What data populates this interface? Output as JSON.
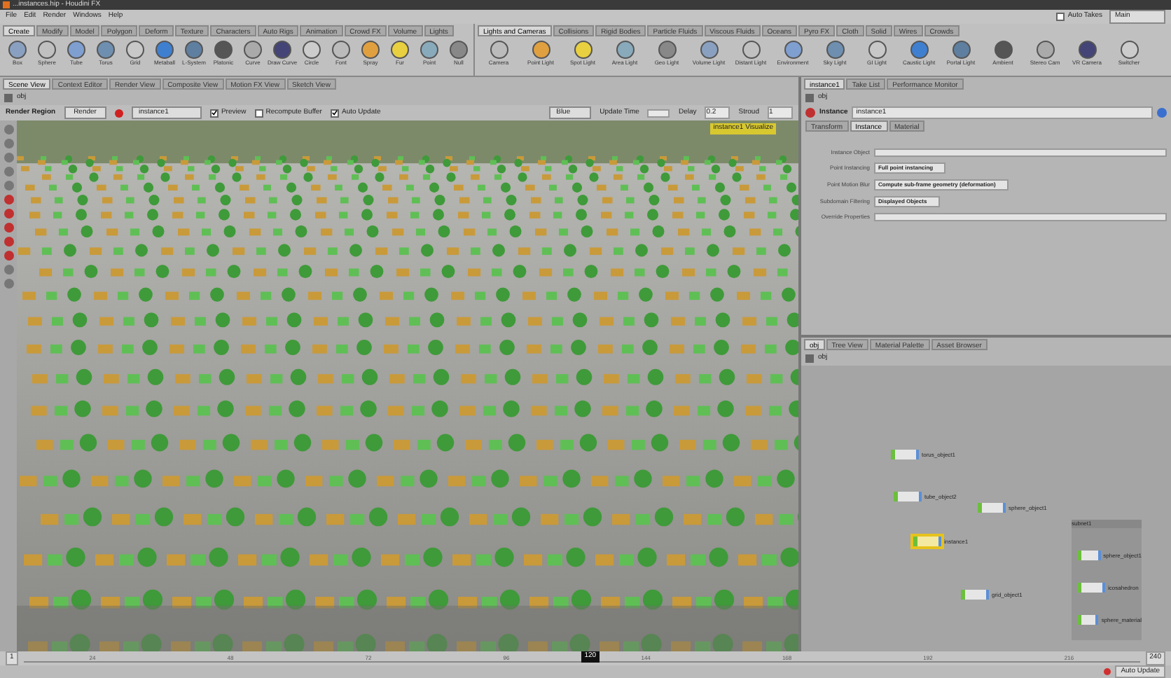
{
  "window": {
    "title": "...instances.hip - Houdini FX"
  },
  "menu": [
    "File",
    "Edit",
    "Render",
    "Windows",
    "Help"
  ],
  "desk": {
    "auto_takes": {
      "label": "Auto Takes",
      "checked": false
    },
    "take": "Main"
  },
  "shelf_tabs": [
    {
      "label": "Create",
      "selected": true
    },
    {
      "label": "Modify",
      "selected": false
    },
    {
      "label": "Model",
      "selected": false
    },
    {
      "label": "Polygon",
      "selected": false
    },
    {
      "label": "Deform",
      "selected": false
    },
    {
      "label": "Texture",
      "selected": false
    },
    {
      "label": "Characters",
      "selected": false
    },
    {
      "label": "Auto Rigs",
      "selected": false
    },
    {
      "label": "Animation",
      "selected": false
    },
    {
      "label": "Crowd FX",
      "selected": false
    },
    {
      "label": "Volume",
      "selected": false
    },
    {
      "label": "Lights",
      "selected": false
    }
  ],
  "shelf_tools": [
    "Box",
    "Sphere",
    "Tube",
    "Torus",
    "Grid",
    "Metaball",
    "L-System",
    "Platonic",
    "Curve",
    "Draw Curve",
    "Circle",
    "Font",
    "Spray",
    "Fur",
    "Point",
    "Null"
  ],
  "light_tabs": [
    {
      "label": "Lights and Cameras",
      "selected": true
    },
    {
      "label": "Collisions",
      "selected": false
    },
    {
      "label": "Rigid Bodies",
      "selected": false
    },
    {
      "label": "Particle Fluids",
      "selected": false
    },
    {
      "label": "Viscous Fluids",
      "selected": false
    },
    {
      "label": "Oceans",
      "selected": false
    },
    {
      "label": "Pyro FX",
      "selected": false
    },
    {
      "label": "Cloth",
      "selected": false
    },
    {
      "label": "Solid",
      "selected": false
    },
    {
      "label": "Wires",
      "selected": false
    },
    {
      "label": "Crowds",
      "selected": false
    }
  ],
  "light_tools": [
    "Camera",
    "Point Light",
    "Spot Light",
    "Area Light",
    "Geo Light",
    "Volume Light",
    "Distant Light",
    "Environment",
    "Sky Light",
    "GI Light",
    "Caustic Light",
    "Portal Light",
    "Ambient",
    "Stereo Cam",
    "VR Camera",
    "Switcher"
  ],
  "view_tabs": [
    {
      "label": "Scene View",
      "selected": true
    },
    {
      "label": "Context Editor",
      "selected": false
    },
    {
      "label": "Render View",
      "selected": false
    },
    {
      "label": "Composite View",
      "selected": false
    },
    {
      "label": "Motion FX View",
      "selected": false
    },
    {
      "label": "Sketch View",
      "selected": false
    }
  ],
  "view_path": "obj",
  "render_bar": {
    "title": "Render Region",
    "render": "Render",
    "camera": "instance1",
    "preview": {
      "label": "Preview",
      "checked": true
    },
    "buffer": {
      "label": "Recompute Buffer",
      "checked": false
    },
    "auto": {
      "label": "Auto Update",
      "checked": true
    },
    "channel": "Blue",
    "update_time": "Update Time",
    "delay": "Delay",
    "delay_value": "0.2",
    "stroud": "Stroud",
    "stroud_value": "1"
  },
  "viewport_badge": "instance1 Visualize",
  "param_tabs": [
    {
      "label": "instance1",
      "selected": true
    },
    {
      "label": "Take List",
      "selected": false
    },
    {
      "label": "Performance Monitor",
      "selected": false
    }
  ],
  "param_path": "obj",
  "node": {
    "type": "Instance",
    "name": "instance1"
  },
  "param_sections": [
    {
      "label": "Transform",
      "selected": false
    },
    {
      "label": "Instance",
      "selected": true
    },
    {
      "label": "Material",
      "selected": false
    }
  ],
  "params": [
    {
      "kind": "field",
      "label": "Instance Object"
    },
    {
      "kind": "menu",
      "label": "Point Instancing",
      "value": "Full point instancing"
    },
    {
      "kind": "menu",
      "label": "Point Motion Blur",
      "value": "Compute sub-frame geometry (deformation)"
    },
    {
      "kind": "menu",
      "label": "Subdomain Filtering",
      "value": "Displayed Objects"
    },
    {
      "kind": "field",
      "label": "Override Properties"
    }
  ],
  "net_tabs": [
    {
      "label": "obj",
      "selected": true
    },
    {
      "label": "Tree View",
      "selected": false
    },
    {
      "label": "Material Palette",
      "selected": false
    },
    {
      "label": "Asset Browser",
      "selected": false
    }
  ],
  "net_path": "obj",
  "nodes": [
    {
      "name": "torus_object1",
      "selected": false
    },
    {
      "name": "tube_object2",
      "selected": false
    },
    {
      "name": "sphere_object1",
      "selected": false
    },
    {
      "name": "instance1",
      "selected": true
    },
    {
      "name": "grid_object1",
      "selected": false
    }
  ],
  "subnet": {
    "name": "subnet1",
    "nodes": [
      {
        "name": "sphere_object1",
        "selected": false
      },
      {
        "name": "icosahedron",
        "selected": false
      },
      {
        "name": "sphere_material",
        "selected": false
      }
    ]
  },
  "timeline": {
    "start": "1",
    "end": "240",
    "frame": "120",
    "level": 0.5,
    "ticks": [
      "24",
      "48",
      "72",
      "96",
      "144",
      "168",
      "192",
      "216"
    ]
  },
  "status": {
    "auto_update": "Auto Update"
  }
}
